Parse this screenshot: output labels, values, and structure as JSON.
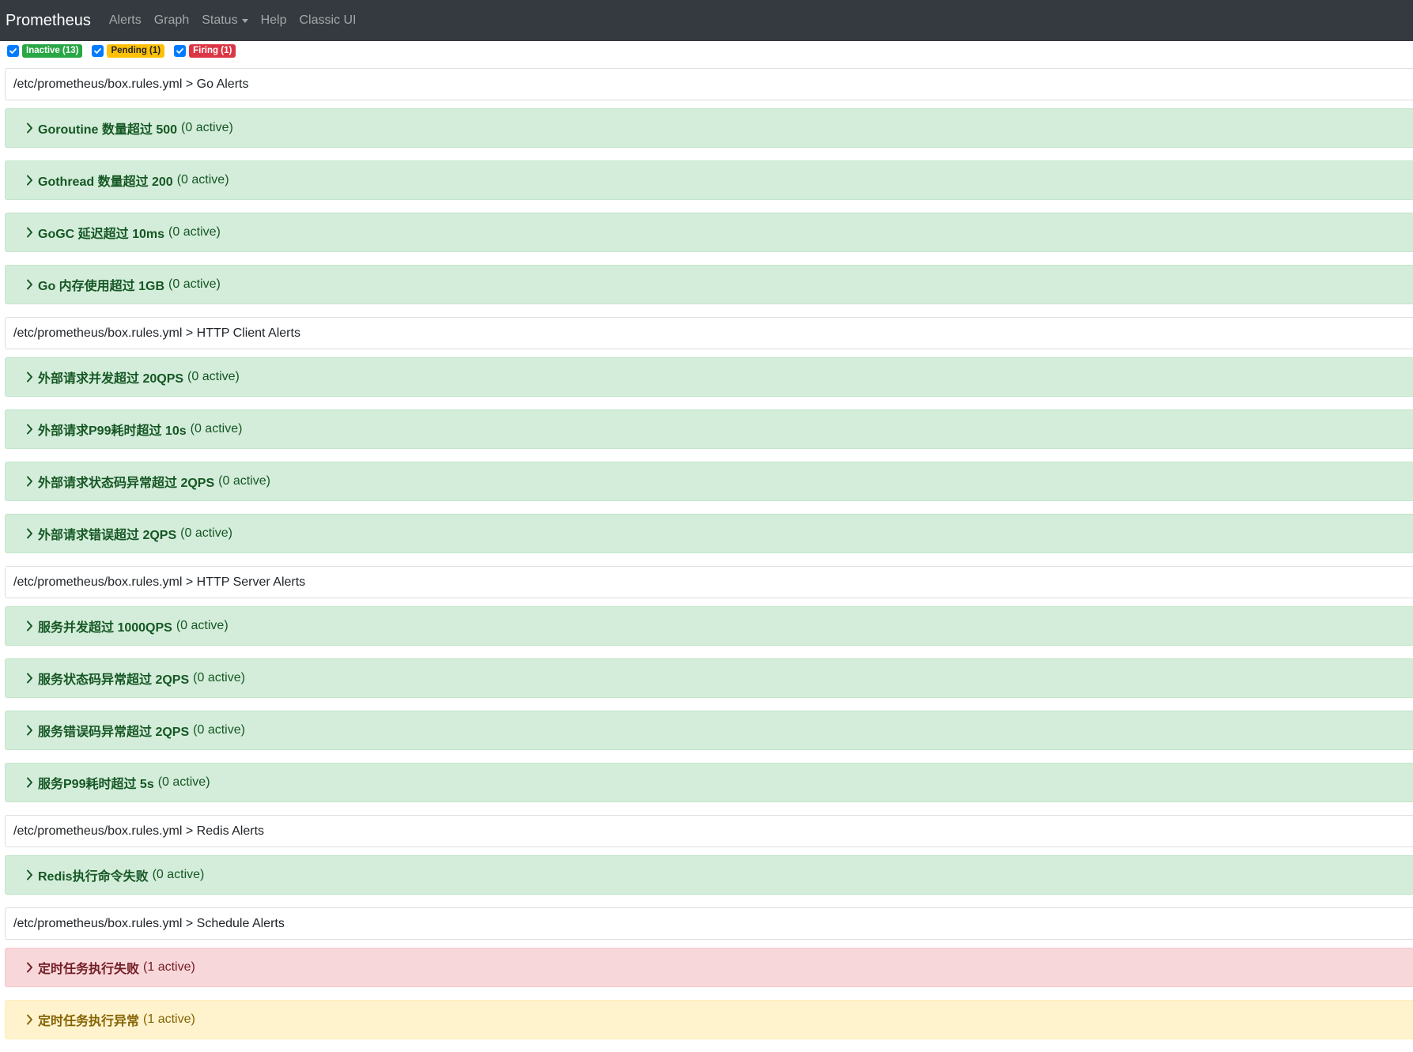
{
  "navbar": {
    "brand": "Prometheus",
    "links": [
      "Alerts",
      "Graph",
      "Status",
      "Help",
      "Classic UI"
    ]
  },
  "filters": [
    {
      "label": "Inactive (13)",
      "checked": true,
      "color": "#28a745"
    },
    {
      "label": "Pending (1)",
      "checked": true,
      "color": "#ffc107"
    },
    {
      "label": "Firing (1)",
      "checked": true,
      "color": "#dc3545"
    }
  ],
  "groups": [
    {
      "header": "/etc/prometheus/box.rules.yml > Go Alerts",
      "rules": [
        {
          "name": "Goroutine 数量超过 500",
          "count": "(0 active)",
          "state": "inactive"
        },
        {
          "name": "Gothread 数量超过 200",
          "count": "(0 active)",
          "state": "inactive"
        },
        {
          "name": "GoGC 延迟超过 10ms",
          "count": "(0 active)",
          "state": "inactive"
        },
        {
          "name": "Go 内存使用超过 1GB",
          "count": "(0 active)",
          "state": "inactive"
        }
      ]
    },
    {
      "header": "/etc/prometheus/box.rules.yml > HTTP Client Alerts",
      "rules": [
        {
          "name": "外部请求并发超过 20QPS",
          "count": "(0 active)",
          "state": "inactive"
        },
        {
          "name": "外部请求P99耗时超过 10s",
          "count": "(0 active)",
          "state": "inactive"
        },
        {
          "name": "外部请求状态码异常超过 2QPS",
          "count": "(0 active)",
          "state": "inactive"
        },
        {
          "name": "外部请求错误超过 2QPS",
          "count": "(0 active)",
          "state": "inactive"
        }
      ]
    },
    {
      "header": "/etc/prometheus/box.rules.yml > HTTP Server Alerts",
      "rules": [
        {
          "name": "服务并发超过 1000QPS",
          "count": "(0 active)",
          "state": "inactive"
        },
        {
          "name": "服务状态码异常超过 2QPS",
          "count": "(0 active)",
          "state": "inactive"
        },
        {
          "name": "服务错误码异常超过 2QPS",
          "count": "(0 active)",
          "state": "inactive"
        },
        {
          "name": "服务P99耗时超过 5s",
          "count": "(0 active)",
          "state": "inactive"
        }
      ]
    },
    {
      "header": "/etc/prometheus/box.rules.yml > Redis Alerts",
      "rules": [
        {
          "name": "Redis执行命令失败",
          "count": "(0 active)",
          "state": "inactive"
        }
      ]
    },
    {
      "header": "/etc/prometheus/box.rules.yml > Schedule Alerts",
      "rules": [
        {
          "name": "定时任务执行失败",
          "count": "(1 active)",
          "state": "firing"
        },
        {
          "name": "定时任务执行异常",
          "count": "(1 active)",
          "state": "pending"
        }
      ]
    }
  ]
}
